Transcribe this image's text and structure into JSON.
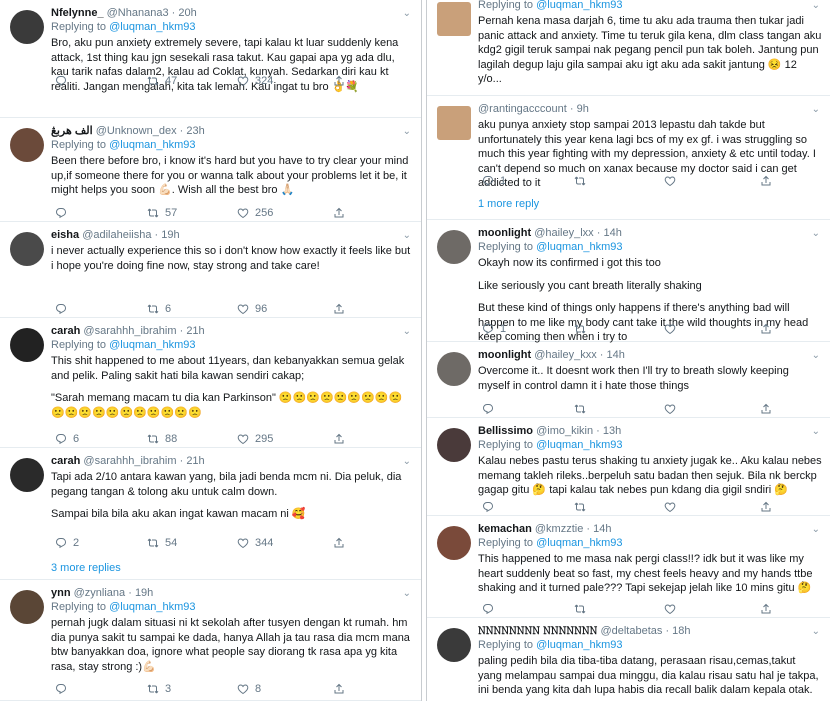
{
  "mention": "@luqman_hkm93",
  "replying_prefix": "Replying to ",
  "more_replies_3": "3 more replies",
  "more_replies_1": "1 more reply",
  "left": [
    {
      "name": "Nfelynne_",
      "handle": "@Nhanana3",
      "time": "20h",
      "reply": true,
      "text": [
        "Bro, aku pun anxiety extremely severe, tapi kalau kt luar suddenly kena attack, 1st thing kau jgn sesekali rasa takut. Kau gapai apa yg ada dlu, kau tarik nafas dalam2, kalau ad Coklat, kunyah. Sedarkan diri kau kt realiti. Jangan mengalah, kita tak lemah. Kau ingat tu bro 👌💐"
      ],
      "stats": {
        "replies": "",
        "retweets": "47",
        "likes": "324"
      }
    },
    {
      "name": "الف هربڠ",
      "handle": "@Unknown_dex",
      "time": "23h",
      "reply": true,
      "text": [
        "Been there before bro, i know it's hard but you have to try clear your mind up,if someone there for you or wanna talk about your problems let it be, it might helps you soon 💪🏻. Wish all the best bro 🙏🏻"
      ],
      "stats": {
        "replies": "",
        "retweets": "57",
        "likes": "256"
      }
    },
    {
      "name": "eisha",
      "handle": "@adilaheiisha",
      "time": "19h",
      "reply": false,
      "text": [
        "i never actually experience this so i don't know how exactly it feels like but i hope you're doing fine now, stay strong and take care!"
      ],
      "stats": {
        "replies": "",
        "retweets": "6",
        "likes": "96"
      }
    },
    {
      "name": "carah",
      "handle": "@sarahhh_ibrahim",
      "time": "21h",
      "reply": true,
      "text": [
        "This shit happened to me about 11years, dan kebanyakkan semua gelak and pelik. Paling sakit hati bila kawan sendiri cakap;",
        "\"Sarah memang macam tu dia kan Parkinson\" 🙁🙁🙁🙁🙁🙁🙁🙁🙁🙁🙁🙁🙁🙁🙁🙁🙁🙁🙁🙁"
      ],
      "stats": {
        "replies": "6",
        "retweets": "88",
        "likes": "295"
      }
    },
    {
      "name": "carah",
      "handle": "@sarahhh_ibrahim",
      "time": "21h",
      "reply": false,
      "text": [
        "Tapi ada 2/10 antara kawan yang, bila jadi benda mcm ni. Dia peluk, dia pegang tangan & tolong aku untuk calm down.",
        "Sampai bila bila aku akan ingat kawan macam ni 🥰"
      ],
      "stats": {
        "replies": "2",
        "retweets": "54",
        "likes": "344"
      }
    },
    {
      "name": "ynn",
      "handle": "@zynliana",
      "time": "19h",
      "reply": true,
      "text": [
        "pernah jugk dalam situasi ni kt sekolah after tusyen dengan kt rumah. hm dia punya sakit tu sampai ke dada, hanya Allah ja tau rasa dia mcm mana btw banyakkan doa, ignore what people say diorang tk rasa apa yg kita rasa, stay strong :)💪🏻"
      ],
      "stats": {
        "replies": "",
        "retweets": "3",
        "likes": "8"
      }
    }
  ],
  "right": [
    {
      "name": "",
      "handle": "",
      "time": "",
      "reply": true,
      "text": [
        "Pernah kena masa darjah 6, time tu aku ada trauma then tukar jadi panic attack and anxiety. Time tu teruk gila kena, dlm class tangan aku kdg2 gigil teruk sampai nak pegang pencil pun tak boleh. Jantung pun lagilah degup laju gila sampai aku igt aku ada sakit jantung 😣 12 y/o..."
      ],
      "stats": {
        "replies": "",
        "retweets": "",
        "likes": ""
      }
    },
    {
      "name": "",
      "handle": "@rantingacccount",
      "time": "9h",
      "reply": false,
      "text": [
        "aku punya anxiety stop sampai 2013 lepastu dah takde but unfortunately this year kena lagi bcs of my ex gf. i was struggling so much this year fighting with my depression, anxiety & etc until today. I can't depend so much on xanax because my doctor said i can get addicted to it"
      ],
      "stats": {
        "replies": "1",
        "retweets": "",
        "likes": ""
      }
    },
    {
      "name": "moonlight",
      "handle": "@hailey_lxx",
      "time": "14h",
      "reply": true,
      "text": [
        "Okayh now its confirmed i got this too",
        "Like seriously you cant breath literally shaking",
        "But these kind of things only happens if there's anything bad will happen to me like my body cant take it the wild thoughts in my head keep coming then when i try to"
      ],
      "stats": {
        "replies": "1",
        "retweets": "",
        "likes": ""
      }
    },
    {
      "name": "moonlight",
      "handle": "@hailey_kxx",
      "time": "14h",
      "reply": false,
      "text": [
        "Overcome it.. It doesnt work then I'll try to breath slowly keeping myself in control damn it i hate those things"
      ],
      "stats": {
        "replies": "",
        "retweets": "",
        "likes": ""
      }
    },
    {
      "name": "Bellissimo",
      "handle": "@imo_kikin",
      "time": "13h",
      "reply": true,
      "text": [
        "Kalau nebes pastu terus shaking tu anxiety jugak ke.. Aku kalau nebes memang takleh rileks..berpeluh satu badan then sejuk. Bila nk berckp gagap gitu 🤔 tapi kalau tak nebes pun kdang dia gigil sndiri 🤔"
      ],
      "stats": {
        "replies": "",
        "retweets": "",
        "likes": ""
      }
    },
    {
      "name": "kemachan",
      "handle": "@kmzztie",
      "time": "14h",
      "reply": true,
      "text": [
        "This happened to me masa nak pergi class!!? idk but it was like my heart suddenly beat so fast, my chest feels heavy and my hands ttbe shaking and it turned pale??? Tapi sekejap jelah like 10 mins gitu 🤔"
      ],
      "stats": {
        "replies": "",
        "retweets": "",
        "likes": ""
      }
    },
    {
      "name": "𝙽𝙽𝙽𝙽𝙽𝙽𝙽𝙽 𝙽𝙽𝙽𝙽𝙽𝙽𝙽",
      "handle": "@deltabetas",
      "time": "18h",
      "reply": true,
      "text": [
        "paling pedih bila dia tiba-tiba datang, perasaan risau,cemas,takut yang melampau sampai dua minggu, dia kalau risau satu hal je takpa, ini benda yang kita dah lupa habis dia recall balik dalam kepala otak."
      ],
      "stats": {
        "replies": "",
        "retweets": "",
        "likes": ""
      }
    }
  ],
  "colors": {
    "link": "#1b95e0",
    "muted": "#657786",
    "text": "#14171a",
    "divider": "#e6ecf0"
  }
}
